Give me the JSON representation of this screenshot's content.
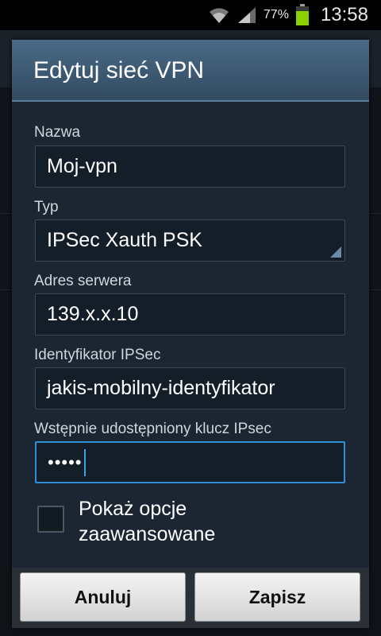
{
  "status_bar": {
    "battery_percent": "77%",
    "time": "13:58",
    "icons": [
      "wifi-icon",
      "signal-icon",
      "battery-icon"
    ]
  },
  "dialog": {
    "title": "Edytuj sieć VPN",
    "fields": {
      "name": {
        "label": "Nazwa",
        "value": "Moj-vpn"
      },
      "type": {
        "label": "Typ",
        "value": "IPSec Xauth PSK"
      },
      "server": {
        "label": "Adres serwera",
        "value": "139.x.x.10"
      },
      "ipsec_id": {
        "label": "Identyfikator IPSec",
        "value": "jakis-mobilny-identyfikator"
      },
      "psk": {
        "label": "Wstępnie udostępniony klucz IPsec",
        "value": "•••••"
      }
    },
    "advanced": {
      "label": "Pokaż opcje zaawansowane",
      "checked": false
    },
    "buttons": {
      "cancel": "Anuluj",
      "save": "Zapisz"
    }
  },
  "colors": {
    "accent": "#2d8fd5",
    "battery": "#8bd000",
    "header": "#3f5c76"
  }
}
